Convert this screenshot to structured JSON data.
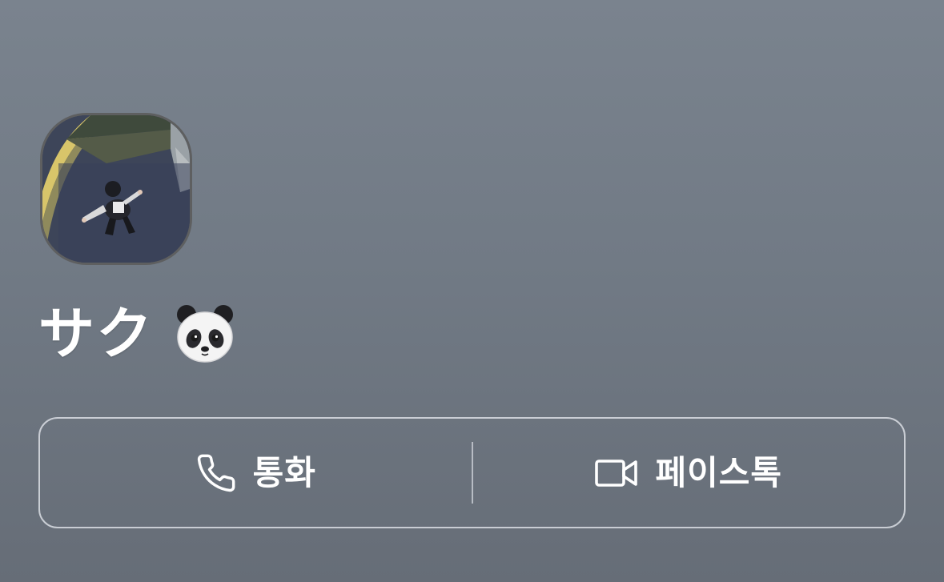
{
  "contact": {
    "name": "サク",
    "emoji_icon": "panda-face-emoji"
  },
  "actions": {
    "call": {
      "label": "통화",
      "icon": "phone-icon"
    },
    "facetime": {
      "label": "페이스톡",
      "icon": "video-camera-icon"
    }
  },
  "colors": {
    "background_top": "#7a838e",
    "background_bottom": "#666d77",
    "text": "#ffffff",
    "button_border": "#dadee4"
  }
}
